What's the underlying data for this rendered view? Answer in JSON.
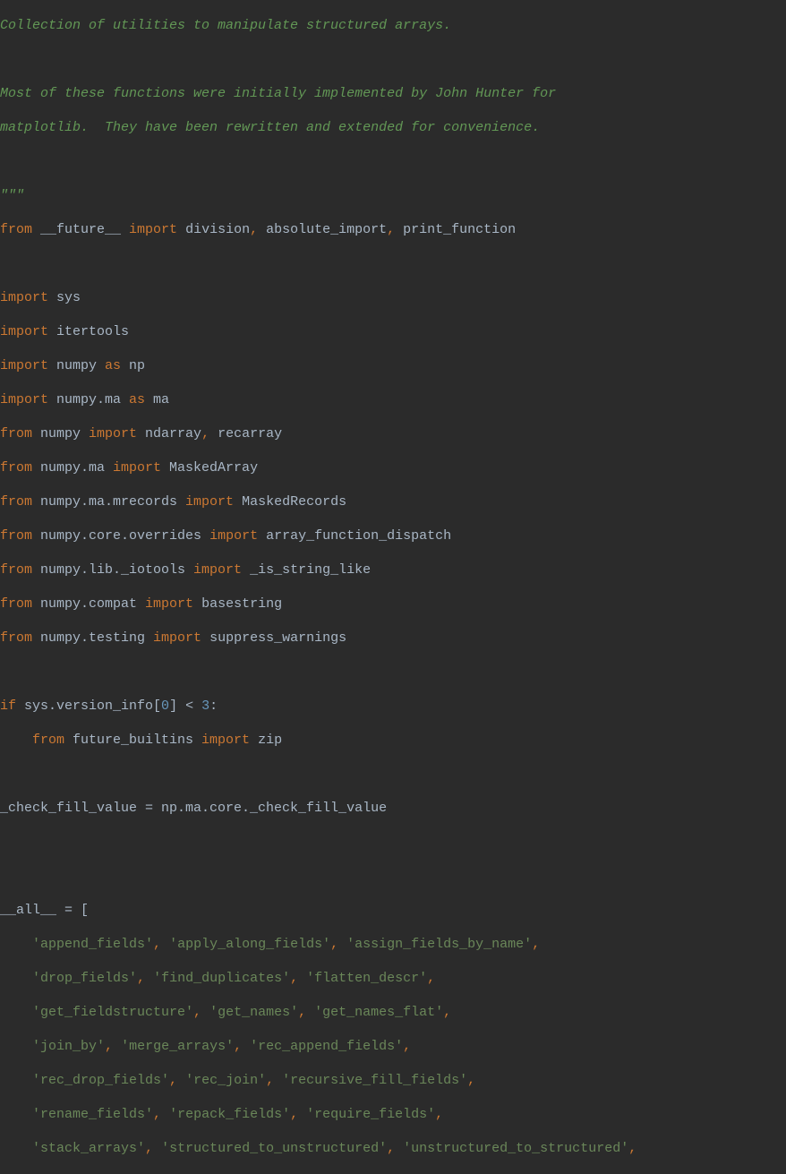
{
  "code": {
    "doc1": "Collection of utilities to manipulate structured arrays.",
    "doc2": "",
    "doc3": "Most of these functions were initially implemented by John Hunter for",
    "doc4": "matplotlib.  They have been rewritten and extended for convenience.",
    "doc5": "",
    "doc6": "\"\"\"",
    "from1": "from",
    "future": " __future__ ",
    "import1": "import",
    "future_items": " division",
    "comma": ",",
    "abs_import": " absolute_import",
    "print_func": " print_function",
    "import_kw": "import",
    "sys": " sys",
    "itertools": " itertools",
    "numpy": " numpy ",
    "as_kw": "as",
    "np": " np",
    "numpy_ma": " numpy.ma ",
    "ma": " ma",
    "from_kw": "from",
    "numpy_sp": " numpy ",
    "ndarray": " ndarray",
    "recarray": " recarray",
    "numpy_ma_sp": " numpy.ma ",
    "masked_array": " MaskedArray",
    "numpy_ma_mrecords": " numpy.ma.mrecords ",
    "masked_records": " MaskedRecords",
    "numpy_core_overrides": " numpy.core.overrides ",
    "array_func_dispatch": " array_function_dispatch",
    "numpy_lib_iotools": " numpy.lib._iotools ",
    "is_string_like": " _is_string_like",
    "numpy_compat": " numpy.compat ",
    "basestring": " basestring",
    "numpy_testing": " numpy.testing ",
    "suppress_warnings": " suppress_warnings",
    "if_kw": "if",
    "sys_version": " sys.version_info[",
    "zero": "0",
    "bracket_lt": "] < ",
    "three": "3",
    "colon": ":",
    "indent_from": "    from",
    "future_builtins": " future_builtins ",
    "zip": " zip",
    "check_fill": "_check_fill_value = np.ma.core._check_fill_value",
    "all_decl": "__all__ = [",
    "indent4": "    ",
    "str_append_fields": "'append_fields'",
    "str_apply_along": "'apply_along_fields'",
    "str_assign_fields": "'assign_fields_by_name'",
    "str_drop_fields": "'drop_fields'",
    "str_find_dup": "'find_duplicates'",
    "str_flatten_descr": "'flatten_descr'",
    "str_get_fieldstruct": "'get_fieldstructure'",
    "str_get_names": "'get_names'",
    "str_get_names_flat": "'get_names_flat'",
    "str_join_by": "'join_by'",
    "str_merge_arrays": "'merge_arrays'",
    "str_rec_append": "'rec_append_fields'",
    "str_rec_drop": "'rec_drop_fields'",
    "str_rec_join": "'rec_join'",
    "str_recursive_fill": "'recursive_fill_fields'",
    "str_rename_fields": "'rename_fields'",
    "str_repack_fields": "'repack_fields'",
    "str_require_fields": "'require_fields'",
    "str_stack_arrays": "'stack_arrays'",
    "str_struct_to_unstruct": "'structured_to_unstructured'",
    "str_unstruct_to_struct": "'unstructured_to_structured'",
    "space": " "
  }
}
